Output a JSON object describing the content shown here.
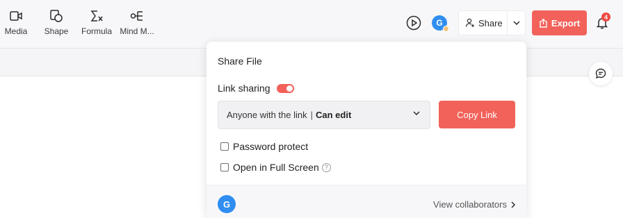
{
  "toolbar": {
    "tools": [
      {
        "label": "Media",
        "icon": "media-icon"
      },
      {
        "label": "Shape",
        "icon": "shape-icon"
      },
      {
        "label": "Formula",
        "icon": "formula-icon"
      },
      {
        "label": "Mind M...",
        "icon": "mind-map-icon"
      }
    ],
    "avatar_initial": "G",
    "share_label": "Share",
    "export_label": "Export",
    "notification_count": "4"
  },
  "share_panel": {
    "title": "Share File",
    "link_sharing_label": "Link sharing",
    "link_sharing_enabled": true,
    "access_scope": "Anyone with the link",
    "separator": "|",
    "access_permission": "Can edit",
    "copy_link_label": "Copy Link",
    "options": [
      {
        "label": "Password protect",
        "checked": false
      },
      {
        "label": "Open in Full Screen",
        "checked": false,
        "help": "?"
      }
    ],
    "collaborator_initial": "G",
    "view_collaborators_label": "View collaborators"
  },
  "colors": {
    "accent": "#f2625a",
    "avatar": "#2f8ef0",
    "badge": "#f04a43"
  }
}
